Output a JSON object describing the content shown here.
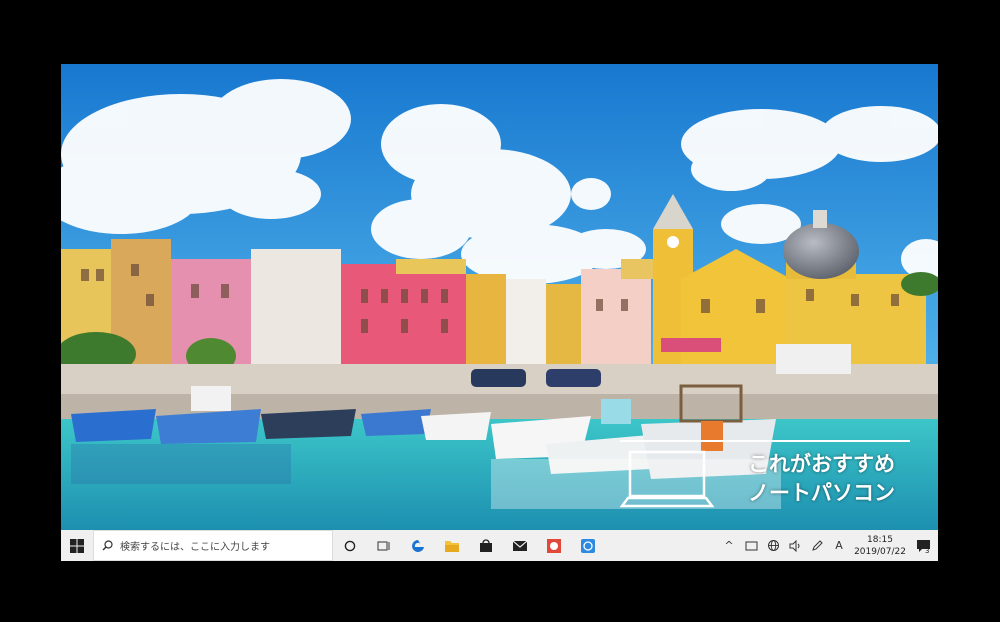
{
  "desktop": {
    "wallpaper": "harbor-town-photo",
    "watermark": {
      "line1": "これがおすすめ",
      "line2": "ノートパソコン"
    }
  },
  "taskbar": {
    "search": {
      "placeholder": "検索するには、ここに入力します"
    },
    "apps": [
      {
        "name": "task-view-icon"
      },
      {
        "name": "edge-browser-icon"
      },
      {
        "name": "file-explorer-icon"
      },
      {
        "name": "store-icon"
      },
      {
        "name": "mail-icon"
      },
      {
        "name": "app-red-icon"
      },
      {
        "name": "app-blue-icon"
      }
    ],
    "tray": {
      "chevron": "^",
      "ime": "A",
      "time": "18:15",
      "date": "2019/07/22",
      "notification_count": "3"
    }
  },
  "colors": {
    "taskbar_bg": "#f0f0f0",
    "accent": "#0078d7",
    "sky": "#2a8fd6",
    "sea": "#35b9c3"
  }
}
